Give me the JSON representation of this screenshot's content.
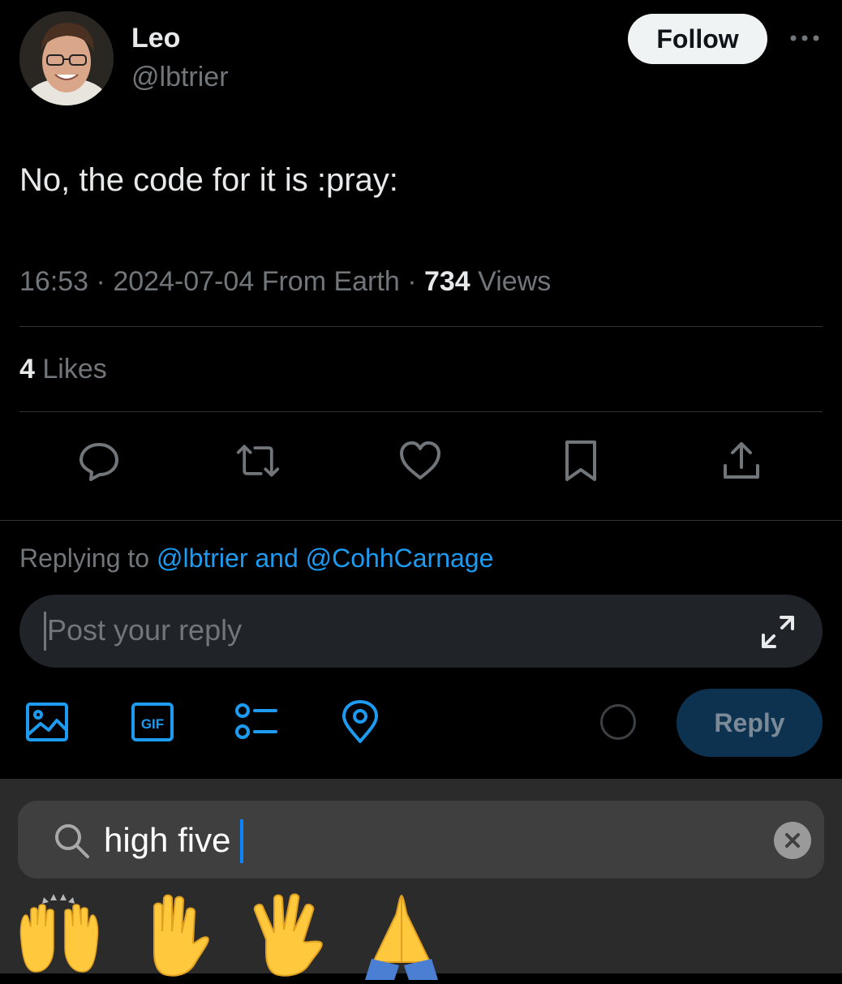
{
  "author": {
    "name": "Leo",
    "handle": "@lbtrier",
    "follow_label": "Follow"
  },
  "tweet": {
    "text": "No, the code for it is :pray:",
    "time": "16:53",
    "date": "2024-07-04",
    "source": "From Earth",
    "views_count": "734",
    "views_label": "Views",
    "likes_count": "4",
    "likes_label": "Likes"
  },
  "actions": [
    "reply-icon",
    "retweet-icon",
    "like-icon",
    "bookmark-icon",
    "share-icon"
  ],
  "reply": {
    "replying_prefix": "Replying to",
    "mention_1": "@lbtrier",
    "joiner": "and",
    "mention_2": "@CohhCarnage",
    "placeholder": "Post your reply",
    "button_label": "Reply"
  },
  "composer_tools": [
    "image-icon",
    "gif-icon",
    "poll-icon",
    "location-icon"
  ],
  "gif_label": "GIF",
  "emoji_search": {
    "query": "high five"
  },
  "emoji_results": [
    "🙌",
    "✋",
    "🖐",
    "🙏"
  ],
  "colors": {
    "accent": "#1d9bf0",
    "reply_button_bg": "#0c3250",
    "background": "#000000",
    "keyboard_bg": "#2b2b2b"
  }
}
